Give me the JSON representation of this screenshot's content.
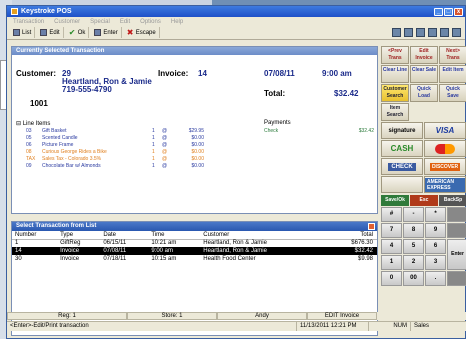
{
  "window": {
    "title": "Keystroke POS"
  },
  "menu": [
    "Transaction",
    "Customer",
    "Special",
    "Edit",
    "Options",
    "Help"
  ],
  "toolbar": [
    {
      "label": "List",
      "icon": "binoculars-icon"
    },
    {
      "label": "Edit",
      "icon": "edit-icon"
    },
    {
      "label": "Ok",
      "icon": "check-icon"
    },
    {
      "label": "Enter",
      "icon": "enter-icon"
    },
    {
      "label": "Escape",
      "icon": "x-icon"
    }
  ],
  "transaction": {
    "panel_title": "Currently Selected Transaction",
    "customer_label": "Customer:",
    "customer_number": "29",
    "customer_name": "Heartland, Ron & Jamie",
    "customer_phone": "719-555-4790",
    "customer_id": "1001",
    "invoice_label": "Invoice:",
    "invoice_number": "14",
    "date": "07/08/11",
    "time": "9:00 am",
    "total_label": "Total:",
    "total": "$32.42",
    "line_items_label": "Line Items",
    "payments_label": "Payments",
    "payment_method": "Check",
    "payment_amount": "$32.42",
    "items": [
      {
        "code": "03",
        "desc": "Gift Basket",
        "qty": "1",
        "unit": "@",
        "price": "$29.95",
        "orange": false
      },
      {
        "code": "05",
        "desc": "Scented Candle",
        "qty": "1",
        "unit": "@",
        "price": "$0.00",
        "orange": false
      },
      {
        "code": "06",
        "desc": "Picture Frame",
        "qty": "1",
        "unit": "@",
        "price": "$0.00",
        "orange": false
      },
      {
        "code": "08",
        "desc": "Curious George Rides a Bike",
        "qty": "1",
        "unit": "@",
        "price": "$0.00",
        "orange": true
      },
      {
        "code": "TAX",
        "desc": "Sales Tax - Colorado 3.5%",
        "qty": "1",
        "unit": "@",
        "price": "$0.00",
        "orange": true
      },
      {
        "code": "09",
        "desc": "Chocolate Bar w/ Almonds",
        "qty": "1",
        "unit": "@",
        "price": "$0.00",
        "orange": false
      }
    ]
  },
  "select": {
    "title": "Select Transaction from List",
    "columns": [
      "Number",
      "Type",
      "Date",
      "Time",
      "Customer",
      "Total"
    ],
    "rows": [
      [
        "1",
        "GiftReg",
        "06/15/11",
        "10:21 am",
        "Heartland, Ron & Jamie",
        "$676.30"
      ],
      [
        "14",
        "Invoice",
        "07/08/11",
        "9:00 am",
        "Heartland, Ron & Jamie",
        "$32.42"
      ],
      [
        "30",
        "Invoice",
        "07/18/11",
        "10:15 am",
        "Health Food Center",
        "$9.98"
      ]
    ],
    "selected_index": 1
  },
  "status_row": [
    "Reg: 1",
    "Store: 1",
    "Andy",
    "EDIT Invoice"
  ],
  "status_bar": {
    "hint": "<Enter>-Edit/Print transaction",
    "datetime": "11/13/2011 12:21 PM",
    "num": "NUM",
    "mode": "Sales"
  },
  "buttons": [
    {
      "label": "<Prev Trans",
      "cls": "pink"
    },
    {
      "label": "Edit Invoice",
      "cls": "pink"
    },
    {
      "label": "Next> Trans",
      "cls": "pink"
    },
    {
      "label": "Clear Line",
      "cls": "blue"
    },
    {
      "label": "Clear Sale",
      "cls": "blue"
    },
    {
      "label": "Edit Item",
      "cls": "blue"
    },
    {
      "label": "Customer Search",
      "cls": "yellow"
    },
    {
      "label": "Quick Load",
      "cls": "blue"
    },
    {
      "label": "Quick Save",
      "cls": "blue"
    },
    {
      "label": "Item Search",
      "cls": ""
    }
  ],
  "payment_cards": [
    "signature",
    "VISA",
    "CASH",
    "MasterCard",
    "CHECK",
    "DISCOVER",
    "",
    "AMERICAN EXPRESS"
  ],
  "fn_buttons": [
    "Save/Ok",
    "Esc",
    "BackSp"
  ],
  "keypad": [
    "#",
    "-",
    "*",
    "",
    "7",
    "8",
    "9",
    "",
    "4",
    "5",
    "6",
    "Enter",
    "1",
    "2",
    "3",
    "",
    "0",
    "00",
    ".",
    ""
  ]
}
